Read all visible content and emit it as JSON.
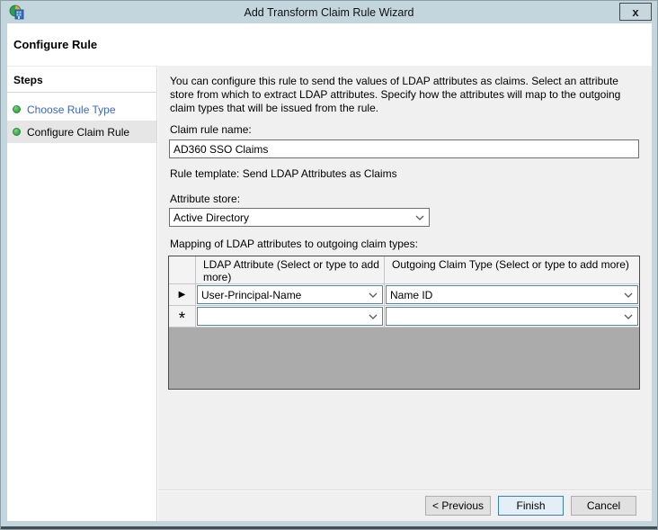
{
  "window": {
    "title": "Add Transform Claim Rule Wizard",
    "close_label": "x"
  },
  "header": {
    "title": "Configure Rule"
  },
  "sidebar": {
    "title": "Steps",
    "items": [
      {
        "label": "Choose Rule Type",
        "state": "completed-link"
      },
      {
        "label": "Configure Claim Rule",
        "state": "current"
      }
    ]
  },
  "main": {
    "description": "You can configure this rule to send the values of LDAP attributes as claims. Select an attribute store from which to extract LDAP attributes. Specify how the attributes will map to the outgoing claim types that will be issued from the rule.",
    "claim_rule_name_label": "Claim rule name:",
    "claim_rule_name_value": "AD360 SSO Claims",
    "rule_template": "Rule template: Send LDAP Attributes as Claims",
    "attribute_store_label": "Attribute store:",
    "attribute_store_value": "Active Directory",
    "mapping_label": "Mapping of LDAP attributes to outgoing claim types:",
    "grid": {
      "columns": [
        "LDAP Attribute (Select or type to add more)",
        "Outgoing Claim Type (Select or type to add more)"
      ],
      "rows": [
        {
          "marker": "▶",
          "ldap_attribute": "User-Principal-Name",
          "outgoing_claim_type": "Name ID"
        },
        {
          "marker": "*",
          "ldap_attribute": "",
          "outgoing_claim_type": ""
        }
      ]
    }
  },
  "footer": {
    "previous_label": "< Previous",
    "finish_label": "Finish",
    "cancel_label": "Cancel"
  },
  "colors": {
    "titlebar_bg": "#c3d5dd",
    "content_bg": "#f0f0f0",
    "step_link_blue": "#3a66c4",
    "step_bullet_green": "#3fae49",
    "grid_filler_gray": "#ababab",
    "grid_combo_border_blue": "#4f82b8",
    "finish_button_border": "#3c7fb1"
  }
}
